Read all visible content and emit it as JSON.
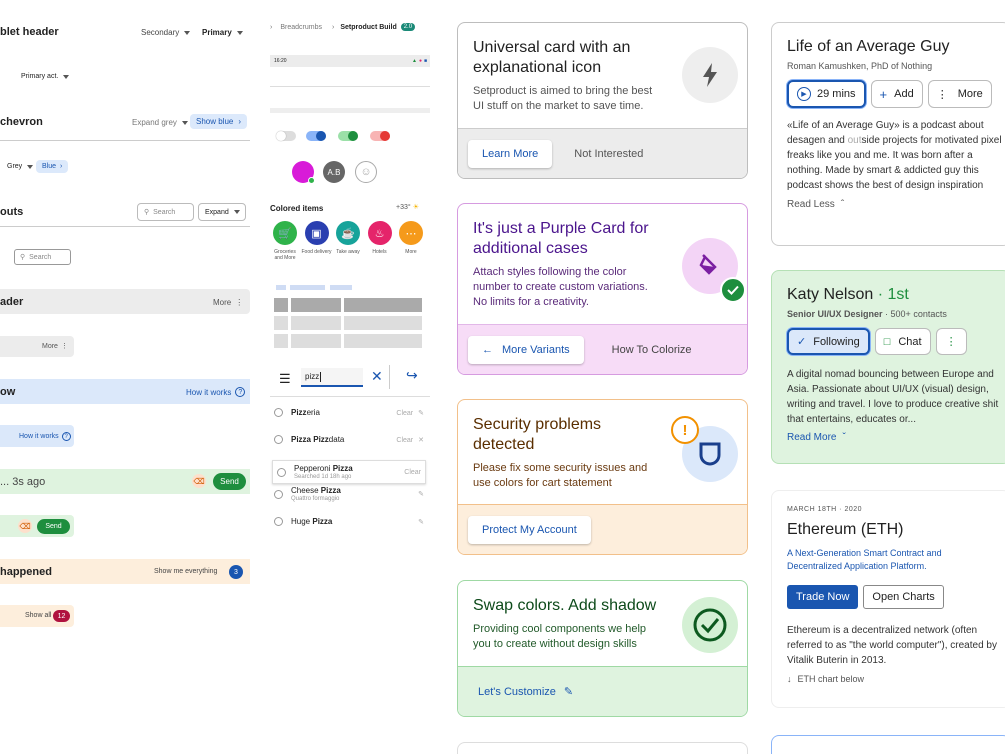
{
  "col1": {
    "tablet_header": "blet header",
    "secondary": "Secondary",
    "primary": "Primary",
    "primary_act": "Primary act.",
    "chevron_title": "chevron",
    "expand_grey": "Expand grey",
    "show_blue": "Show blue",
    "grey": "Grey",
    "blue": "Blue",
    "inputs_title": "outs",
    "search1": "Search",
    "expand": "Expand",
    "search2": "Search",
    "header_title": "ader",
    "more1": "More",
    "more2": "More",
    "show_title": "ow",
    "how_it_works1": "How it works",
    "how_it_works2": "How it works",
    "ago_text": "... 3s ago",
    "send1": "Send",
    "send2": "Send",
    "happened": "happened",
    "show_me_everything": "Show me everything",
    "badge1": "3",
    "show_all": "Show all",
    "badge2": "12"
  },
  "col2": {
    "breadcrumbs": "Breadcrumbs",
    "product": "Setproduct Build",
    "version": "2.0",
    "time": "16:20",
    "avatar_initials": "A.B",
    "colored_items": "Colored items",
    "weather": "+33°",
    "items": [
      {
        "label": "Groceries and More",
        "color": "#2fb34a"
      },
      {
        "label": "Food delivery",
        "color": "#2a3fb0"
      },
      {
        "label": "Take away",
        "color": "#17a39a"
      },
      {
        "label": "Hotels",
        "color": "#e5246a"
      },
      {
        "label": "More",
        "color": "#f59a1b"
      }
    ],
    "search_value": "pizz",
    "suggestions": [
      {
        "pre": "Pizz",
        "post": "eria",
        "sub": "",
        "action": "Clear"
      },
      {
        "pre": "Pizza Pizz",
        "post": "data",
        "sub": "",
        "action": "Clear"
      },
      {
        "pre": "Pepperoni ",
        "post": "Pizza",
        "sub": "Searched 1d 18h ago",
        "action": "Clear"
      },
      {
        "pre": "Cheese ",
        "post": "Pizza",
        "sub": "Quattro formaggio",
        "action": ""
      },
      {
        "pre": "Huge ",
        "post": "Pizza",
        "sub": "",
        "action": ""
      }
    ]
  },
  "cards": {
    "universal": {
      "title": "Universal card with an explanational icon",
      "text": "Setproduct is aimed to bring the best UI stuff on the market to save time.",
      "btn1": "Learn More",
      "btn2": "Not Interested"
    },
    "purple": {
      "title": "It's just a Purple Card for additional cases",
      "text": "Attach styles following the color number to create custom variations. No limits for a creativity.",
      "btn1": "More Variants",
      "btn2": "How To Colorize"
    },
    "security": {
      "title": "Security problems detected",
      "text": "Please fix some security issues and use colors for cart statement",
      "btn1": "Protect My Account"
    },
    "swap": {
      "title": "Swap colors. Add shadow",
      "text": "Providing cool components we help you to create without design skills",
      "btn1": "Let's Customize"
    }
  },
  "right": {
    "podcast": {
      "title": "Life of an Average Guy",
      "author": "Roman Kamushken, PhD of Nothing",
      "duration": "29 mins",
      "add": "Add",
      "more": "More",
      "desc_pre": "«Life of an Average Guy» is a podcast about desagen and ",
      "desc_hl": "out",
      "desc_post": "side projects for motivated pixel freaks like you and me. It was born after a nothing. Made by smart & addicted guy this podcast shows the best of design inspiration",
      "read_less": "Read Less"
    },
    "profile": {
      "name": "Katy Nelson",
      "degree": "· 1st",
      "role": "Senior UI/UX Designer",
      "contacts": "· 500+ contacts",
      "following": "Following",
      "chat": "Chat",
      "desc": "A digital nomad bouncing between Europe and Asia. Passionate about UI/UX (visual) design, writing and travel. I love to produce creative shit that entertains, educates or...",
      "read_more": "Read More"
    },
    "eth": {
      "date": "MARCH 18TH · 2020",
      "title": "Ethereum (ETH)",
      "subtitle": "A Next-Generation Smart Contract and Decentralized Application Platform.",
      "trade": "Trade Now",
      "open": "Open Charts",
      "desc": "Ethereum is a decentralized network (often referred to as \"the world computer\"), created by Vitalik Buterin in 2013.",
      "chart_below": "ETH chart below"
    }
  },
  "colors": {
    "blue": "#1a56b0",
    "purple": "#6a1b9a",
    "green": "#1e7e34",
    "orange": "#7a3c00"
  }
}
